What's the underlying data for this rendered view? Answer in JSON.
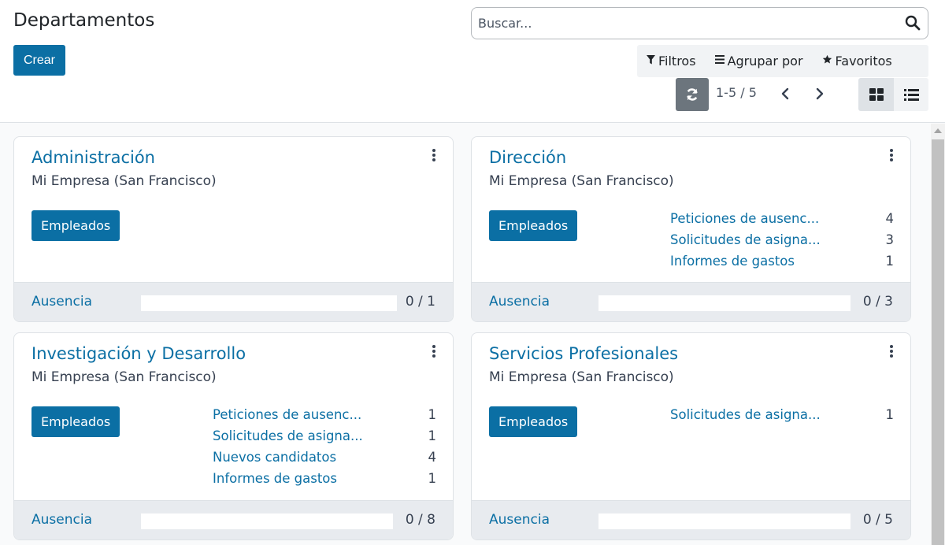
{
  "page": {
    "title": "Departamentos"
  },
  "toolbar": {
    "create_label": "Crear"
  },
  "search": {
    "placeholder": "Buscar..."
  },
  "filters": [
    {
      "label": "Filtros",
      "icon": "filter-icon"
    },
    {
      "label": "Agrupar por",
      "icon": "group-by-icon"
    },
    {
      "label": "Favoritos",
      "icon": "star-icon"
    }
  ],
  "pager": {
    "value": "1-5 / 5"
  },
  "views": {
    "active": "kanban"
  },
  "cards": [
    {
      "title": "Administración",
      "company": "Mi Empresa (San Francisco)",
      "button": "Empleados",
      "stats": [],
      "footer": {
        "label": "Ausencia",
        "count": "0 / 1",
        "progress": 0
      }
    },
    {
      "title": "Dirección",
      "company": "Mi Empresa (San Francisco)",
      "button": "Empleados",
      "stats": [
        {
          "label": "Peticiones de ausenc...",
          "count": "4"
        },
        {
          "label": "Solicitudes de asigna...",
          "count": "3"
        },
        {
          "label": "Informes de gastos",
          "count": "1"
        }
      ],
      "footer": {
        "label": "Ausencia",
        "count": "0 / 3",
        "progress": 0
      }
    },
    {
      "title": "Investigación y Desarrollo",
      "company": "Mi Empresa (San Francisco)",
      "button": "Empleados",
      "stats": [
        {
          "label": "Peticiones de ausenc...",
          "count": "1"
        },
        {
          "label": "Solicitudes de asigna...",
          "count": "1"
        },
        {
          "label": "Nuevos candidatos",
          "count": "4"
        },
        {
          "label": "Informes de gastos",
          "count": "1"
        }
      ],
      "footer": {
        "label": "Ausencia",
        "count": "0 / 8",
        "progress": 0
      }
    },
    {
      "title": "Servicios Profesionales",
      "company": "Mi Empresa (San Francisco)",
      "button": "Empleados",
      "stats": [
        {
          "label": "Solicitudes de asigna...",
          "count": "1"
        }
      ],
      "footer": {
        "label": "Ausencia",
        "count": "0 / 5",
        "progress": 0
      }
    }
  ],
  "colors": {
    "primary": "#0b6fa4",
    "secondary": "#6c757d",
    "footer_bg": "#e8ebef"
  }
}
